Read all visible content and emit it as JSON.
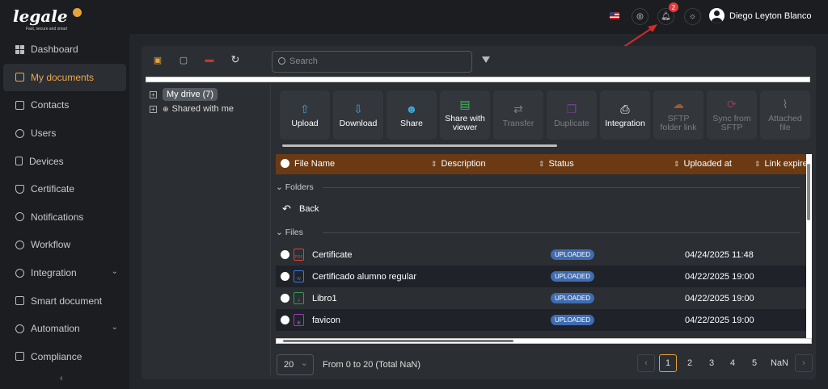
{
  "brand": {
    "logo": "legale",
    "tagline": "Fast, secure and smart"
  },
  "sidebar": {
    "items": [
      {
        "label": "Dashboard",
        "icon": "dashboard-icon"
      },
      {
        "label": "My documents",
        "icon": "folder-icon",
        "active": true
      },
      {
        "label": "Contacts",
        "icon": "contacts-icon"
      },
      {
        "label": "Users",
        "icon": "user-circle-icon"
      },
      {
        "label": "Devices",
        "icon": "device-icon"
      },
      {
        "label": "Certificate",
        "icon": "shield-icon"
      },
      {
        "label": "Notifications",
        "icon": "bell-icon"
      },
      {
        "label": "Workflow",
        "icon": "workflow-icon"
      },
      {
        "label": "Integration",
        "icon": "gear-icon",
        "expandable": true
      },
      {
        "label": "Smart document",
        "icon": "smart-doc-icon"
      },
      {
        "label": "Automation",
        "icon": "automation-icon",
        "expandable": true
      },
      {
        "label": "Compliance",
        "icon": "chat-icon"
      }
    ],
    "collapse": "‹"
  },
  "header": {
    "notifications_count": "2",
    "user_name": "Diego Leyton Blanco",
    "language": "us-flag-icon"
  },
  "toolbar": {
    "search_placeholder": "Search"
  },
  "tree": {
    "drive": "My drive (7)",
    "shared": "Shared with me"
  },
  "actions": [
    {
      "label": "Upload",
      "icon": "upload-icon",
      "enabled": true
    },
    {
      "label": "Download",
      "icon": "download-icon",
      "enabled": true
    },
    {
      "label": "Share",
      "icon": "share-user-icon",
      "enabled": true
    },
    {
      "label": "Share with viewer",
      "icon": "share-viewer-icon",
      "enabled": true
    },
    {
      "label": "Transfer",
      "icon": "transfer-icon",
      "enabled": false
    },
    {
      "label": "Duplicate",
      "icon": "duplicate-icon",
      "enabled": false
    },
    {
      "label": "Integration",
      "icon": "integration-icon",
      "enabled": true
    },
    {
      "label": "SFTP folder link",
      "icon": "sftp-link-icon",
      "enabled": false
    },
    {
      "label": "Sync from SFTP",
      "icon": "sync-icon",
      "enabled": false
    },
    {
      "label": "Attached file",
      "icon": "attach-icon",
      "enabled": false
    }
  ],
  "table": {
    "columns": [
      "File Name",
      "Description",
      "Status",
      "Uploaded at",
      "Link expire"
    ],
    "folders_label": "Folders",
    "back_label": "Back",
    "files_label": "Files",
    "rows": [
      {
        "name": "Certificate",
        "type": "pdf",
        "status": "UPLOADED",
        "uploaded_at": "04/24/2025 11:48"
      },
      {
        "name": "Certificado alumno regular",
        "type": "word",
        "status": "UPLOADED",
        "uploaded_at": "04/22/2025 19:00"
      },
      {
        "name": "Libro1",
        "type": "excel",
        "status": "UPLOADED",
        "uploaded_at": "04/22/2025 19:00"
      },
      {
        "name": "favicon",
        "type": "image",
        "status": "UPLOADED",
        "uploaded_at": "04/22/2025 19:00"
      }
    ]
  },
  "pagination": {
    "page_size": "20",
    "info": "From 0 to 20 (Total NaN)",
    "pages": [
      "1",
      "2",
      "3",
      "4",
      "5",
      "NaN"
    ],
    "current": "1"
  },
  "colors": {
    "accent": "#e8a33c",
    "header_row": "#6b3a13",
    "status": "#3f6cb0",
    "badge": "#e23b3b"
  }
}
